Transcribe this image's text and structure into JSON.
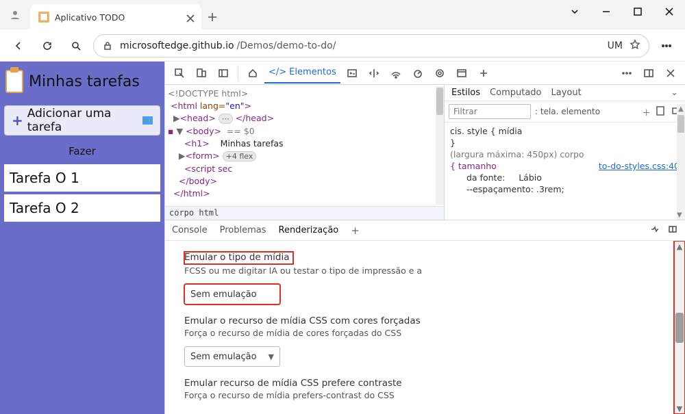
{
  "window": {
    "tab_title": "Aplicativo TODO",
    "profile_badge": "UM"
  },
  "url": {
    "host": "microsoftedge.github.io",
    "path": "/Demos/demo-to-do/"
  },
  "app": {
    "title": "Minhas tarefas",
    "add_button": "Adicionar uma tarefa",
    "section_label": "Fazer",
    "tasks": [
      "Tarefa O 1",
      "Tarefa O 2"
    ]
  },
  "devtools": {
    "active_tab": "Elementos",
    "dom": {
      "doctype": "<!DOCTYPE html>",
      "html_open": "<html lang=\"en\">",
      "head_open": "<head>",
      "head_badge": "⋯",
      "head_close": "</head>",
      "body_open": "<body>",
      "body_flag": "== $0",
      "h1_open": "<h1>",
      "h1_text": "Minhas tarefas",
      "form_open": "<form>",
      "form_badge": "+4 flex",
      "script_text": "<script sec",
      "body_close": "</body>",
      "html_close": "</html>",
      "breadcrumb": "corpo html"
    },
    "styles": {
      "tabs": [
        "Estilos",
        "Computado",
        "Layout"
      ],
      "filter_placeholder": "Filtrar",
      "hover_label": ": tela. elemento",
      "rule1_line1": "cis. style { mídia",
      "rule1_line2": "}",
      "media_line": "(largura máxima: 450px) corpo",
      "open_brace": "{ tamanho",
      "link_text": "to-do-styles.css:40",
      "prop1_key": "da fonte:",
      "prop1_val": "Lábio",
      "prop2": "--espaçamento: .3rem;"
    },
    "drawer": {
      "tabs": [
        "Console",
        "Problemas",
        "Renderização"
      ],
      "section1_heading": "Emular o tipo de mídia",
      "section1_sub": "FCSS ou me digitar IA ou testar o tipo de impressão e a",
      "dropdown1": "Sem emulação",
      "section2_heading": "Emular o recurso de mídia CSS com cores forçadas",
      "section2_sub": "Força o recurso de mídia de cores forçadas do CSS",
      "dropdown2": "Sem emulação",
      "section3_heading": "Emular recurso de mídia CSS prefere contraste",
      "section3_sub": "Força o recurso de mídia prefers-contrast do CSS"
    }
  }
}
